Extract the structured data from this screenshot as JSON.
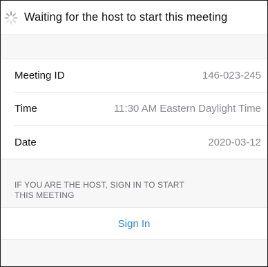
{
  "header": {
    "status_text": "Waiting for the host to start this meeting",
    "spinner_icon": "loading-spinner-icon"
  },
  "details": {
    "rows": [
      {
        "label": "Meeting ID",
        "value": "146-023-245"
      },
      {
        "label": "Time",
        "value": "11:30 AM Eastern Daylight Time"
      },
      {
        "label": "Date",
        "value": "2020-03-12"
      }
    ]
  },
  "host_note": {
    "line1": "IF YOU ARE THE HOST, SIGN IN TO START",
    "line2": "THIS MEETING"
  },
  "sign_in": {
    "label": "Sign In",
    "color": "#1a8cf0"
  }
}
